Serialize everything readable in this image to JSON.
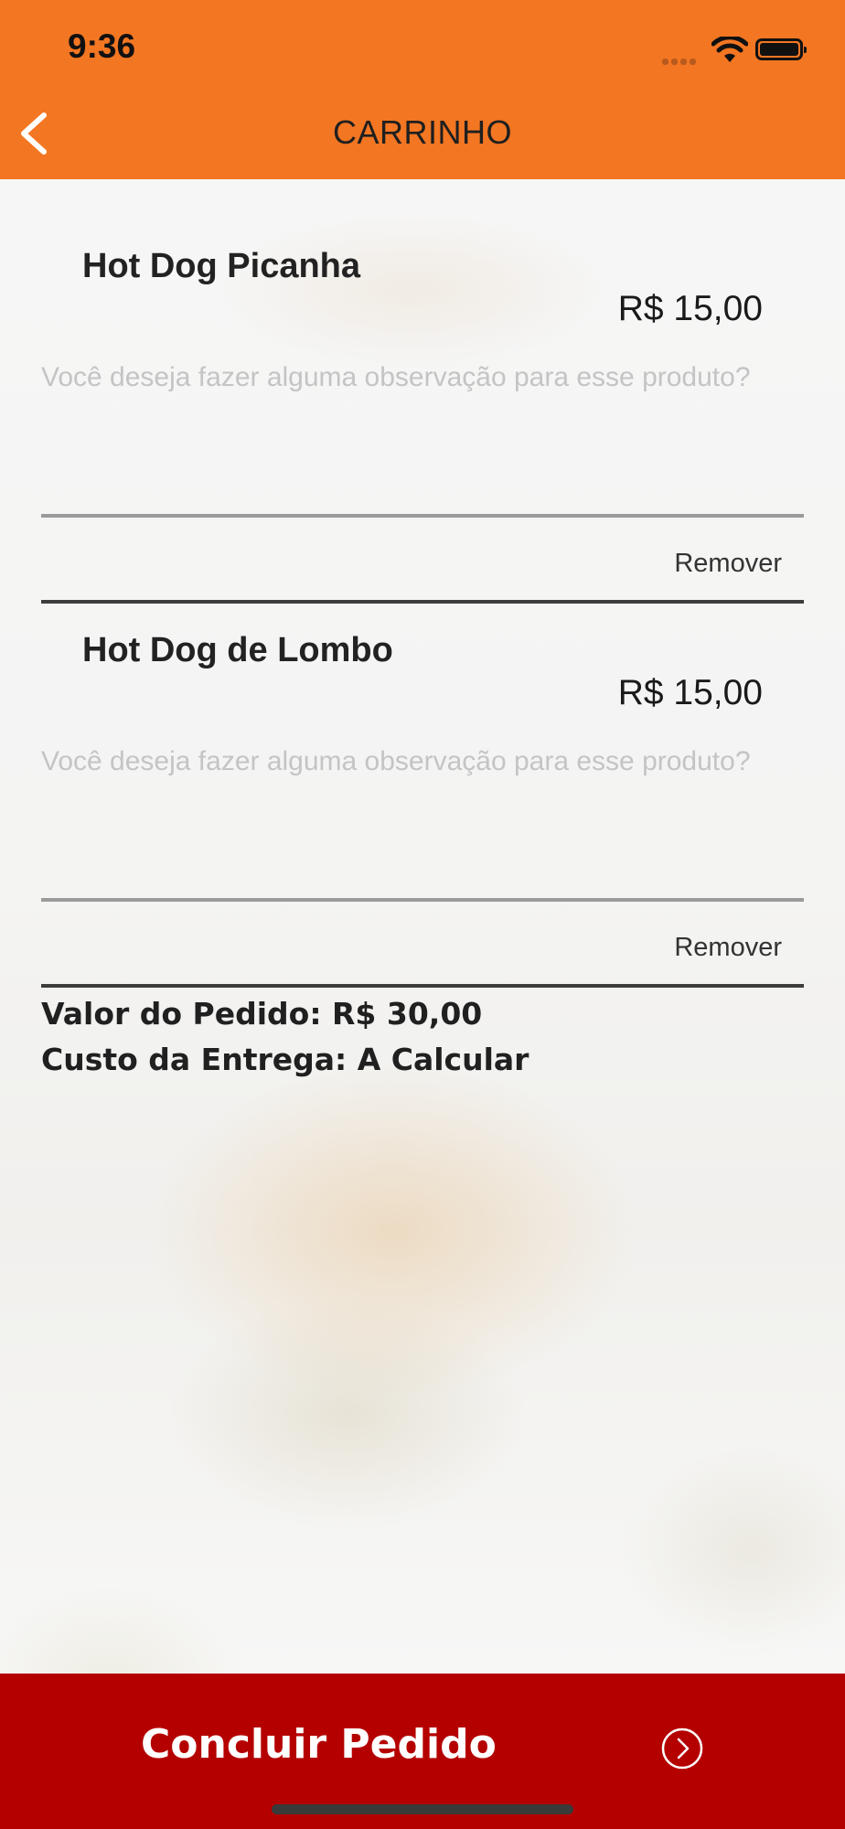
{
  "status_bar": {
    "time": "9:36",
    "icons": [
      "cellular-signal-icon",
      "wifi-icon",
      "battery-icon"
    ]
  },
  "nav": {
    "back_icon": "chevron-left-icon",
    "title": "CARRINHO"
  },
  "cart": {
    "items": [
      {
        "name": "Hot Dog Picanha",
        "price": "R$ 15,00",
        "observation_placeholder": "Você deseja fazer alguma observação para esse produto?",
        "observation_value": "",
        "remove_label": "Remover"
      },
      {
        "name": "Hot Dog de Lombo",
        "price": "R$ 15,00",
        "observation_placeholder": "Você deseja fazer alguma observação para esse produto?",
        "observation_value": "",
        "remove_label": "Remover"
      }
    ]
  },
  "summary": {
    "order_value": "Valor do Pedido: R$ 30,00",
    "delivery_cost": "Custo da Entrega: A Calcular"
  },
  "footer": {
    "conclude_label": "Concluir Pedido",
    "conclude_icon": "chevron-right-circle-icon"
  },
  "colors": {
    "header": "#f37622",
    "footer": "#b50000",
    "background": "#f6f6f6"
  }
}
